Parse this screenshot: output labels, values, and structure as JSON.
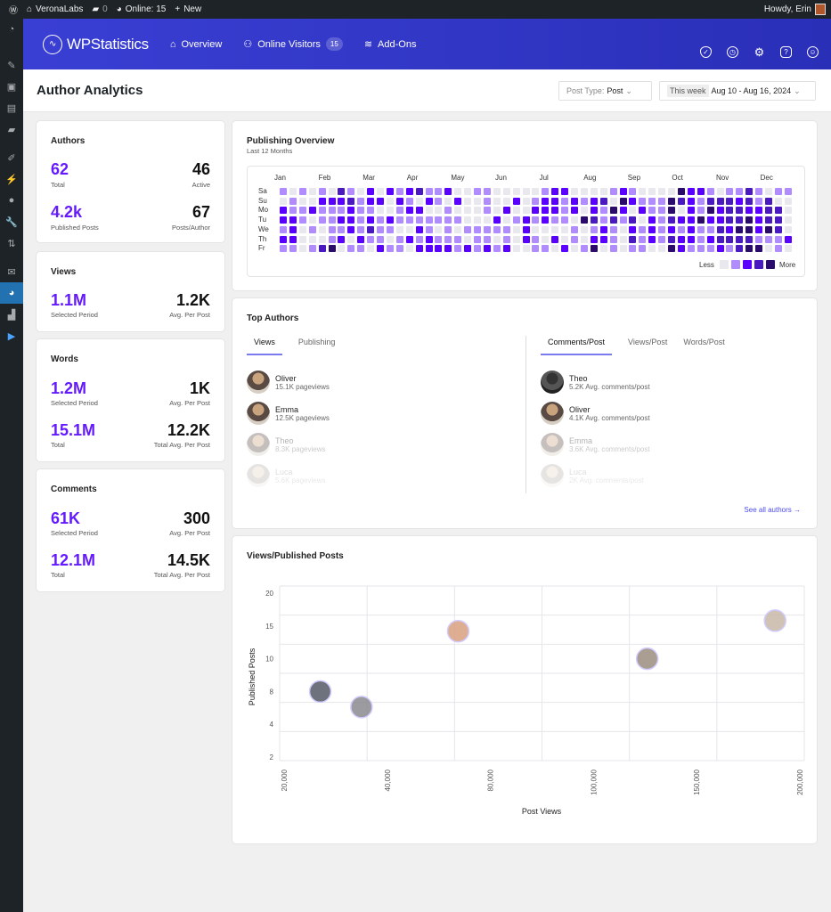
{
  "adminbar": {
    "site": "VeronaLabs",
    "comments": "0",
    "online": "Online: 15",
    "new": "New",
    "howdy": "Howdy, Erin"
  },
  "header": {
    "logo": "WPStatistics",
    "nav": [
      {
        "label": "Overview",
        "icon": "home-icon"
      },
      {
        "label": "Online Visitors",
        "icon": "users-icon",
        "badge": "15"
      },
      {
        "label": "Add-Ons",
        "icon": "layers-icon"
      }
    ],
    "icons": [
      "shield-icon",
      "gauge-icon",
      "gear-icon",
      "help-icon",
      "smile-icon"
    ]
  },
  "page": {
    "title": "Author Analytics",
    "post_type_label": "Post Type:",
    "post_type": "Post",
    "range_tag": "This week",
    "range": "Aug 10 - Aug 16, 2024"
  },
  "authors": {
    "title": "Authors",
    "total": "62",
    "total_label": "Total",
    "active": "46",
    "active_label": "Active",
    "published": "4.2k",
    "published_label": "Published Posts",
    "per_author": "67",
    "per_author_label": "Posts/Author"
  },
  "views": {
    "title": "Views",
    "selected": "1.1M",
    "selected_label": "Selected Period",
    "avg": "1.2K",
    "avg_label": "Avg. Per Post"
  },
  "words": {
    "title": "Words",
    "selected": "1.2M",
    "selected_label": "Selected Period",
    "avg": "1K",
    "avg_label": "Avg. Per Post",
    "total": "15.1M",
    "total_label": "Total",
    "total_avg": "12.2K",
    "total_avg_label": "Total Avg. Per Post"
  },
  "comments": {
    "title": "Comments",
    "selected": "61K",
    "selected_label": "Selected Period",
    "avg": "300",
    "avg_label": "Avg. Per Post",
    "total": "12.1M",
    "total_label": "Total",
    "total_avg": "14.5K",
    "total_avg_label": "Total Avg. Per Post"
  },
  "publishing": {
    "title": "Publishing Overview",
    "subtitle": "Last 12 Months",
    "months": [
      "Jan",
      "Feb",
      "Mar",
      "Apr",
      "May",
      "Jun",
      "Jul",
      "Aug",
      "Sep",
      "Oct",
      "Nov",
      "Dec"
    ],
    "days": [
      "Sa",
      "Su",
      "Mo",
      "Tu",
      "We",
      "Th",
      "Fr"
    ],
    "levels": [
      "10101031020212311200110000012200001210000422101131011",
      "01002223122021021020010020122121230421114321333231300",
      "21121112110012200100010200222120214202114021423322330",
      "22101122121211111110002012121104313130213224223342330",
      "12010112131100210101111102000010121021212121132442430",
      "22000120211012121110110102102010221031213221233331112",
      "11013401102110222212121200110201401011004211121344010"
    ],
    "legend_less": "Less",
    "legend_more": "More",
    "colors": [
      "#e8e8ee",
      "#b18cff",
      "#5a00ff",
      "#4a1ac0",
      "#2a0a6a"
    ]
  },
  "top_authors": {
    "title": "Top Authors",
    "left_tabs": [
      "Views",
      "Publishing"
    ],
    "right_tabs": [
      "Comments/Post",
      "Views/Post",
      "Words/Post"
    ],
    "left": [
      {
        "name": "Oliver",
        "stat": "15.1K pageviews"
      },
      {
        "name": "Emma",
        "stat": "12.5K pageviews"
      },
      {
        "name": "Theo",
        "stat": "8.3K pageviews"
      },
      {
        "name": "Luca",
        "stat": "5.6K pageviews"
      }
    ],
    "right": [
      {
        "name": "Theo",
        "stat": "5.2K Avg. comments/post"
      },
      {
        "name": "Oliver",
        "stat": "4.1K Avg. comments/post"
      },
      {
        "name": "Emma",
        "stat": "3.6K Avg. comments/post"
      },
      {
        "name": "Luca",
        "stat": "2K Avg. comments/post"
      }
    ],
    "see_all": "See all authors →"
  },
  "chart_data": {
    "type": "scatter",
    "title": "Views/Published Posts",
    "xlabel": "Post Views",
    "ylabel": "Published Posts",
    "x_ticks": [
      20000,
      40000,
      80000,
      100000,
      150000,
      200000
    ],
    "x_tick_labels": [
      "20,000",
      "40,000",
      "80,000",
      "100,000",
      "150,000",
      "200,000"
    ],
    "y_ticks": [
      2,
      4,
      8,
      10,
      15,
      20
    ],
    "y_tick_labels": [
      "2",
      "4",
      "8",
      "10",
      "15",
      "20"
    ],
    "grid": true,
    "marker": "author avatar",
    "points": [
      {
        "x": 27000,
        "y": 8
      },
      {
        "x": 35000,
        "y": 6.1
      },
      {
        "x": 67500,
        "y": 14.2
      },
      {
        "x": 126000,
        "y": 10
      },
      {
        "x": 188000,
        "y": 15.8
      }
    ]
  }
}
